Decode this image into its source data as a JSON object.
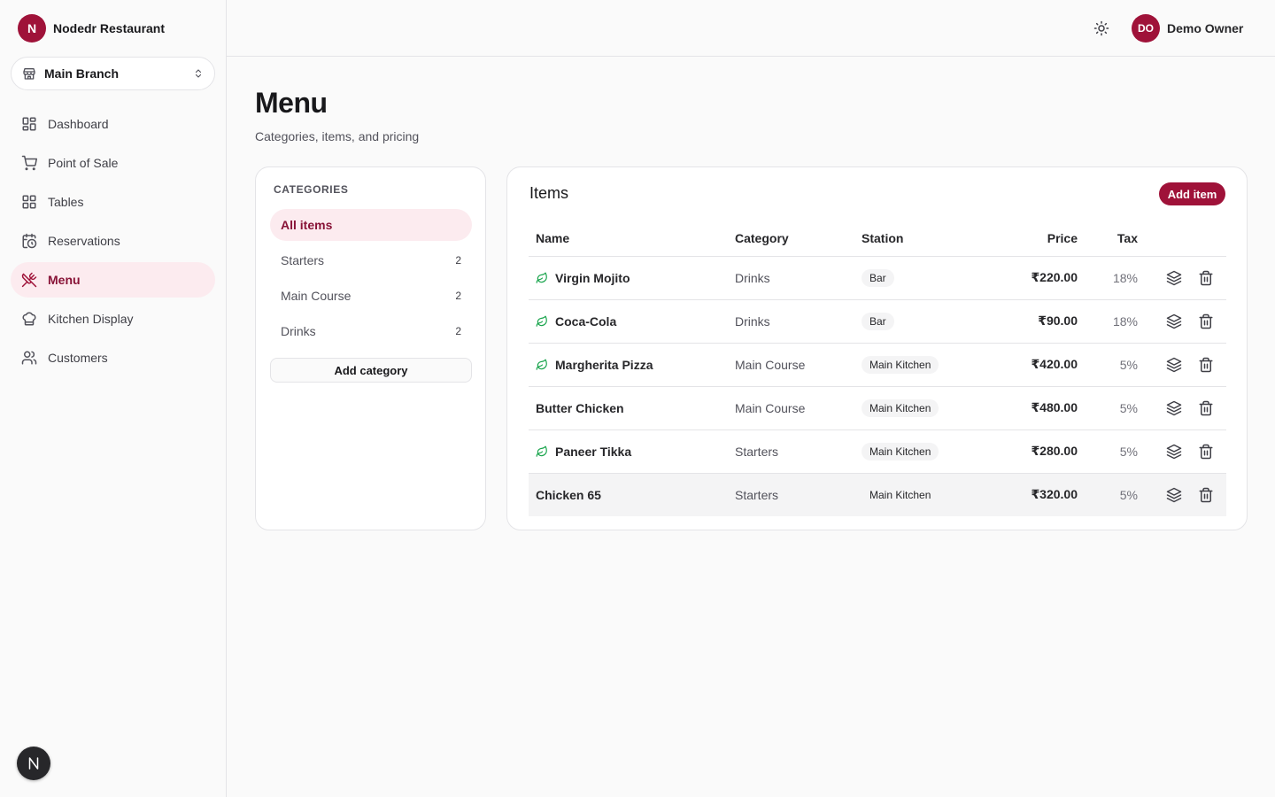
{
  "brand": {
    "initial": "N",
    "name": "Nodedr Restaurant"
  },
  "branch": {
    "label": "Main Branch"
  },
  "nav": {
    "items": [
      {
        "label": "Dashboard",
        "icon": "dashboard-icon"
      },
      {
        "label": "Point of Sale",
        "icon": "cart-icon"
      },
      {
        "label": "Tables",
        "icon": "grid-icon"
      },
      {
        "label": "Reservations",
        "icon": "calendar-clock-icon"
      },
      {
        "label": "Menu",
        "icon": "utensils-icon",
        "active": true
      },
      {
        "label": "Kitchen Display",
        "icon": "chef-hat-icon"
      },
      {
        "label": "Customers",
        "icon": "users-icon"
      }
    ]
  },
  "user": {
    "initials": "DO",
    "name": "Demo Owner"
  },
  "page": {
    "title": "Menu",
    "subtitle": "Categories, items, and pricing"
  },
  "categories": {
    "heading": "CATEGORIES",
    "items": [
      {
        "label": "All items",
        "count": "",
        "active": true
      },
      {
        "label": "Starters",
        "count": "2"
      },
      {
        "label": "Main Course",
        "count": "2"
      },
      {
        "label": "Drinks",
        "count": "2"
      }
    ],
    "add_label": "Add category"
  },
  "items": {
    "title": "Items",
    "add_label": "Add item",
    "columns": {
      "name": "Name",
      "category": "Category",
      "station": "Station",
      "price": "Price",
      "tax": "Tax"
    },
    "rows": [
      {
        "name": "Virgin Mojito",
        "veg": true,
        "category": "Drinks",
        "station": "Bar",
        "price": "₹220.00",
        "tax": "18%"
      },
      {
        "name": "Coca-Cola",
        "veg": true,
        "category": "Drinks",
        "station": "Bar",
        "price": "₹90.00",
        "tax": "18%"
      },
      {
        "name": "Margherita Pizza",
        "veg": true,
        "category": "Main Course",
        "station": "Main Kitchen",
        "price": "₹420.00",
        "tax": "5%"
      },
      {
        "name": "Butter Chicken",
        "veg": false,
        "category": "Main Course",
        "station": "Main Kitchen",
        "price": "₹480.00",
        "tax": "5%"
      },
      {
        "name": "Paneer Tikka",
        "veg": true,
        "category": "Starters",
        "station": "Main Kitchen",
        "price": "₹280.00",
        "tax": "5%"
      },
      {
        "name": "Chicken 65",
        "veg": false,
        "category": "Starters",
        "station": "Main Kitchen",
        "price": "₹320.00",
        "tax": "5%"
      }
    ]
  },
  "colors": {
    "accent": "#9f1239",
    "active_bg": "#fcebef",
    "veg_green": "#16a34a"
  }
}
